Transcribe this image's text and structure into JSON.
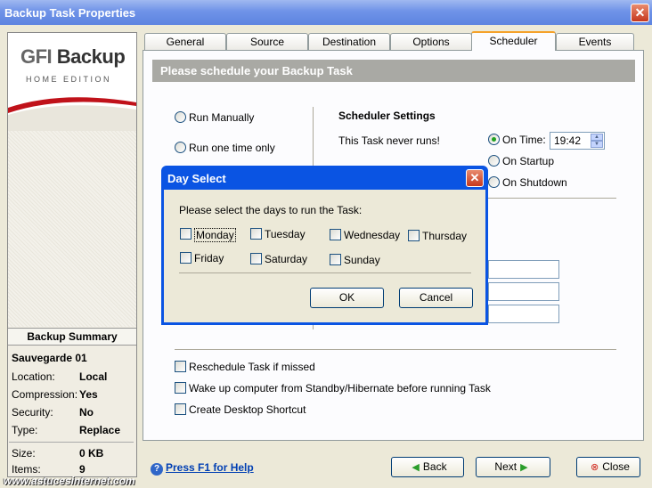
{
  "window": {
    "title": "Backup Task Properties",
    "close_glyph": "✕"
  },
  "logo": {
    "gfi": "GFI",
    "name": "Backup",
    "edition": "HOME EDITION"
  },
  "summary": {
    "heading": "Backup Summary",
    "task_name": "Sauvegarde 01",
    "rows": [
      {
        "key": "Location:",
        "value": "Local"
      },
      {
        "key": "Compression:",
        "value": "Yes"
      },
      {
        "key": "Security:",
        "value": "No"
      },
      {
        "key": "Type:",
        "value": "Replace"
      },
      {
        "key": "Size:",
        "value": "0 KB"
      },
      {
        "key": "Items:",
        "value": "9"
      }
    ]
  },
  "tabs": [
    "General",
    "Source",
    "Destination",
    "Options",
    "Scheduler",
    "Events"
  ],
  "active_tab": "Scheduler",
  "banner": "Please schedule your Backup Task",
  "schedule_options": {
    "manual": "Run Manually",
    "once": "Run one time only"
  },
  "scheduler_settings": {
    "heading": "Scheduler Settings",
    "status": "This Task never runs!",
    "on_time": "On Time:",
    "time_value": "19:42",
    "on_startup": "On Startup",
    "on_shutdown": "On Shutdown"
  },
  "checkboxes": {
    "reschedule": "Reschedule Task if missed",
    "wake": "Wake up computer from Standby/Hibernate before running Task",
    "shortcut": "Create Desktop Shortcut"
  },
  "help": {
    "label": "Press F1 for Help",
    "icon": "?"
  },
  "buttons": {
    "back": "Back",
    "next": "Next",
    "close": "Close"
  },
  "dialog": {
    "title": "Day Select",
    "prompt": "Please select the days to run the Task:",
    "days": [
      "Monday",
      "Tuesday",
      "Wednesday",
      "Thursday",
      "Friday",
      "Saturday",
      "Sunday"
    ],
    "ok": "OK",
    "cancel": "Cancel"
  },
  "watermark": "www.astucesinternet.com",
  "colors": {
    "accent_tab": "#f5a22a",
    "title_blue": "#0a54e3",
    "banner_gray": "#a9a9a4",
    "link_blue": "#003fb3"
  }
}
